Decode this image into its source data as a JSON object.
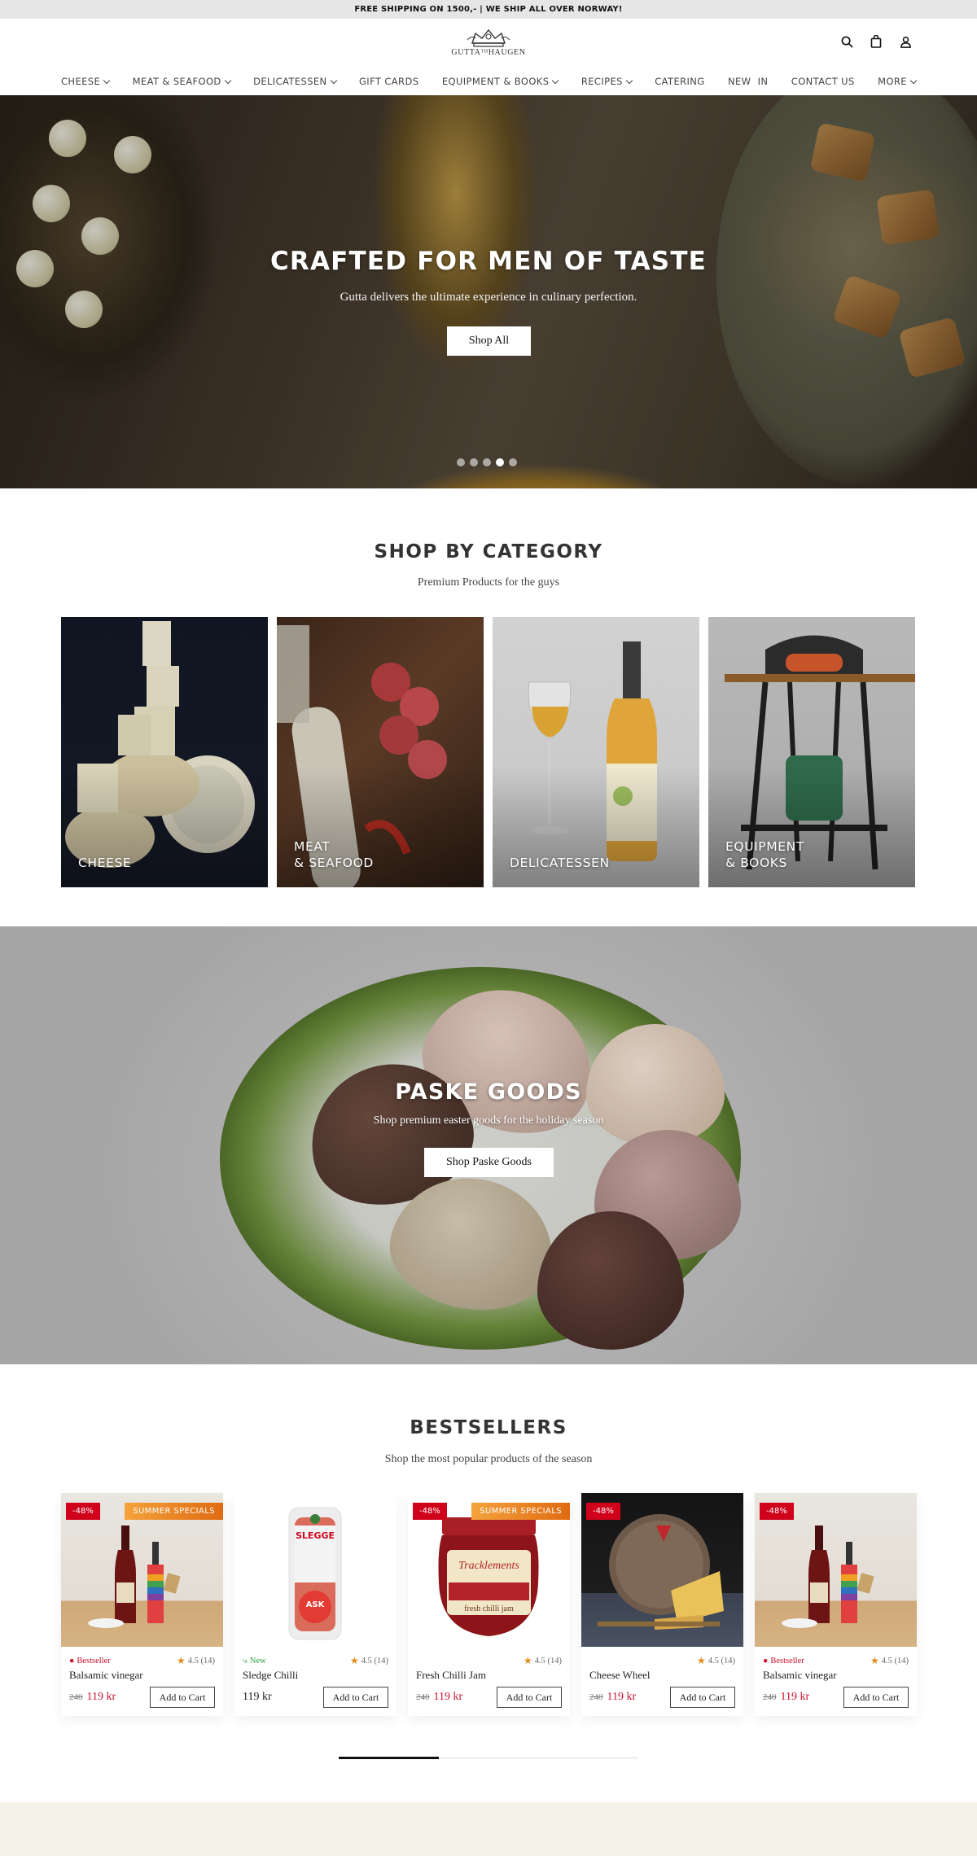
{
  "announcement": "FREE SHIPPING ON 1500,- | WE SHIP ALL OVER NORWAY!",
  "brand": {
    "logo_text": "GUTTAᵀᴴHAUGEN"
  },
  "header_icons": [
    "search-icon",
    "bag-icon",
    "user-icon"
  ],
  "nav": [
    {
      "label": "CHEESE",
      "dropdown": true
    },
    {
      "label": "MEAT & SEAFOOD",
      "dropdown": true
    },
    {
      "label": "DELICATESSEN",
      "dropdown": true
    },
    {
      "label": "GIFT CARDS",
      "dropdown": false
    },
    {
      "label": "EQUIPMENT & BOOKS",
      "dropdown": true
    },
    {
      "label": "RECIPES",
      "dropdown": true
    },
    {
      "label": "CATERING",
      "dropdown": false
    },
    {
      "label": "NEW  IN",
      "dropdown": false
    },
    {
      "label": "CONTACT US",
      "dropdown": false
    },
    {
      "label": "MORE",
      "dropdown": true
    }
  ],
  "hero": {
    "title": "CRAFTED FOR MEN OF TASTE",
    "subtitle": "Gutta delivers the ultimate experience in culinary perfection.",
    "button": "Shop All",
    "slide_count": 5,
    "active_slide": 4
  },
  "categories_section": {
    "title": "SHOP BY CATEGORY",
    "subtitle": "Premium Products for the guys",
    "items": [
      {
        "label": "CHEESE"
      },
      {
        "label": "MEAT\n& SEAFOOD"
      },
      {
        "label": "DELICATESSEN"
      },
      {
        "label": "EQUIPMENT\n& BOOKS"
      }
    ]
  },
  "easter": {
    "title": "PASKE GOODS",
    "subtitle": "Shop premium easter goods for the holiday season",
    "button": "Shop Paske Goods"
  },
  "bestsellers": {
    "title": "BESTSELLERS",
    "subtitle": "Shop the most popular products of the season",
    "cart_label": "Add to Cart",
    "products": [
      {
        "name": "Balsamic vinegar",
        "discount": "-48%",
        "promo": "SUMMER SPECIALS",
        "tag": "Bestseller",
        "tag_type": "best",
        "rating": "4.5 (14)",
        "old_price": "240",
        "price": "119 kr"
      },
      {
        "name": "Sledge Chilli",
        "discount": "",
        "promo": "",
        "tag": "New",
        "tag_type": "new",
        "rating": "4.5 (14)",
        "old_price": "",
        "price": "119 kr"
      },
      {
        "name": "Fresh Chilli Jam",
        "discount": "-48%",
        "promo": "SUMMER SPECIALS",
        "tag": "",
        "tag_type": "",
        "rating": "4.5 (14)",
        "old_price": "240",
        "price": "119 kr"
      },
      {
        "name": "Cheese Wheel",
        "discount": "-48%",
        "promo": "",
        "tag": "",
        "tag_type": "",
        "rating": "4.5 (14)",
        "old_price": "240",
        "price": "119 kr"
      },
      {
        "name": "Balsamic vinegar",
        "discount": "-48%",
        "promo": "",
        "tag": "Bestseller",
        "tag_type": "best",
        "rating": "4.5 (14)",
        "old_price": "240",
        "price": "119 kr"
      }
    ],
    "image_texts": {
      "sledge": "SLEGGE",
      "sledge_sub": "ASK",
      "jam_brand": "Tracklements",
      "jam_sub": "fresh chilli jam"
    }
  },
  "colors": {
    "sale": "#d0021b",
    "promo": "#e8861e",
    "new": "#2e9d3f",
    "footer_band": "#f4f1e6"
  }
}
